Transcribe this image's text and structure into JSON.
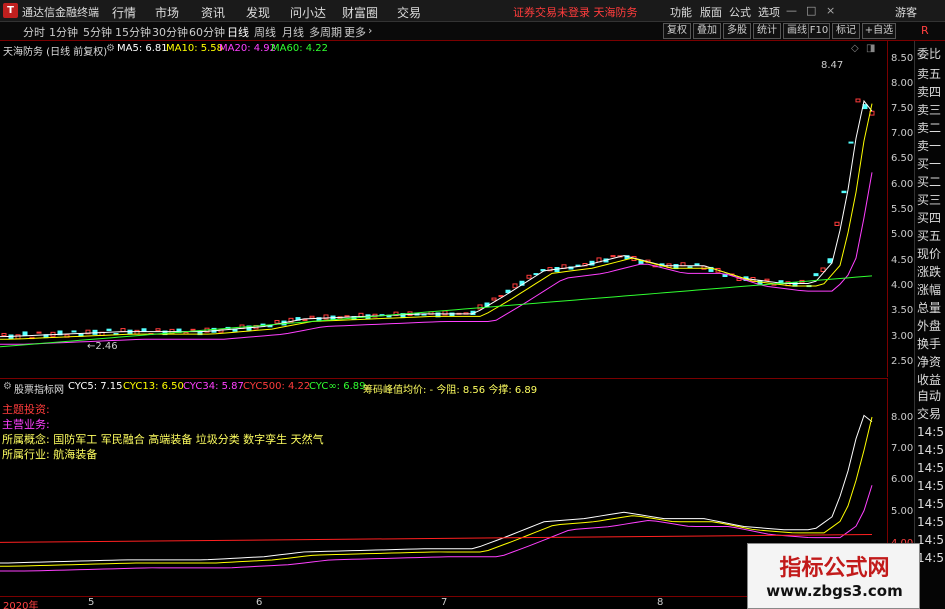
{
  "app": {
    "title": "通达信金融终端",
    "logo": "T"
  },
  "menu": [
    "行情",
    "市场",
    "资讯",
    "发现",
    "问小达",
    "财富圈",
    "交易"
  ],
  "warning": "证券交易未登录  天海防务",
  "right_menu": [
    "功能",
    "版面",
    "公式",
    "选项",
    "游客"
  ],
  "periods": [
    "分时",
    "1分钟",
    "5分钟",
    "15分钟",
    "30分钟",
    "60分钟",
    "日线",
    "周线",
    "月线",
    "多周期",
    "更多"
  ],
  "active_period": "日线",
  "tool_buttons": [
    "复权",
    "叠加",
    "多股",
    "统计",
    "画线",
    "F10",
    "标记",
    "+自选"
  ],
  "main_legend": {
    "stock": "天海防务 (日线 前复权)",
    "ma5": "MA5: 6.81",
    "ma10": "MA10: 5.58",
    "ma20": "MA20: 4.92",
    "ma60": "MA60: 4.22"
  },
  "high_label": "8.47",
  "low_label": "2.46",
  "sub_legend": {
    "name": "股票指标网",
    "cyc5": "CYC5: 7.15",
    "cyc13": "CYC13: 6.50",
    "cyc34": "CYC34: 5.87",
    "cyc500": "CYC500: 4.22",
    "cycinf": "CYC∞: 6.89",
    "chip": "筹码峰值均价: - 今阻: 8.56 今撑: 6.89"
  },
  "info": {
    "main_invest": "主题投资:",
    "main_business": "主营业务:",
    "concept": "所属概念: 国防军工 军民融合 高端装备 垃圾分类 数字孪生 天然气",
    "industry": "所属行业: 航海装备"
  },
  "price_axis": [
    "8.50",
    "8.00",
    "7.50",
    "7.00",
    "6.50",
    "6.00",
    "5.50",
    "5.00",
    "4.50",
    "4.00",
    "3.50",
    "3.00",
    "2.50"
  ],
  "sub_axis": [
    "8.00",
    "7.00",
    "6.00",
    "5.00",
    "4.00"
  ],
  "dates": [
    "2020年",
    "5",
    "6",
    "7",
    "8"
  ],
  "side_panel": [
    "委比",
    "卖五",
    "卖四",
    "卖三",
    "卖二",
    "卖一",
    "买一",
    "买二",
    "买三",
    "买四",
    "买五",
    "现价",
    "涨跌",
    "涨幅",
    "总量",
    "外盘",
    "换手",
    "净资",
    "收益",
    "自动",
    "交易",
    "14:5",
    "14:5",
    "14:5",
    "14:5",
    "14:5",
    "14:5",
    "14:5",
    "14:5"
  ],
  "watermark": {
    "title": "指标公式网",
    "url": "www.zbgs3.com"
  },
  "colors": {
    "up": "#ff3c3c",
    "down": "#54ffff",
    "ma5": "#ffffff",
    "ma10": "#ffff00",
    "ma20": "#ff40ff",
    "ma60": "#30ff30",
    "cyc500": "#ff2020"
  }
}
